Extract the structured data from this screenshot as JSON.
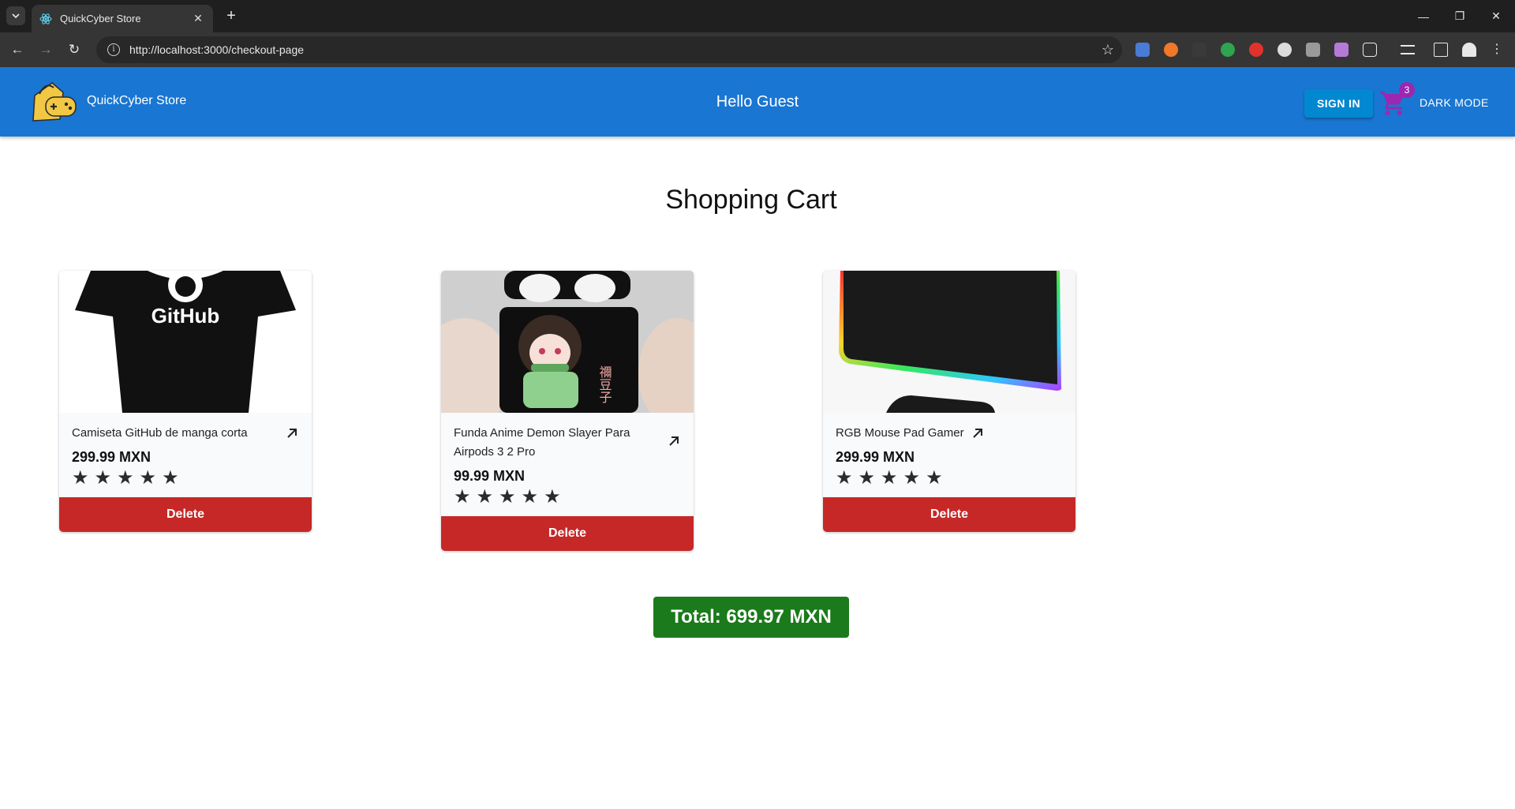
{
  "browser": {
    "tab_title": "QuickCyber Store",
    "url": "http://localhost:3000/checkout-page"
  },
  "header": {
    "brand": "QuickCyber Store",
    "greeting": "Hello Guest",
    "sign_in": "SIGN IN",
    "cart_count": "3",
    "dark_mode": "DARK MODE",
    "colors": {
      "appbar": "#1976d2",
      "sign_in": "#0288d1",
      "cart": "#9c27b0"
    }
  },
  "page": {
    "title": "Shopping Cart",
    "total": "Total: 699.97 MXN"
  },
  "items": [
    {
      "name": "Camiseta GitHub de manga corta",
      "price": "299.99 MXN",
      "rating": 5,
      "image_text": "GitHub",
      "delete": "Delete"
    },
    {
      "name": "Funda Anime Demon Slayer Para Airpods 3 2 Pro",
      "price": "99.99 MXN",
      "rating": 5,
      "image_text": "禰豆子",
      "delete": "Delete"
    },
    {
      "name": "RGB Mouse Pad Gamer",
      "price": "299.99 MXN",
      "rating": 5,
      "delete": "Delete"
    }
  ]
}
